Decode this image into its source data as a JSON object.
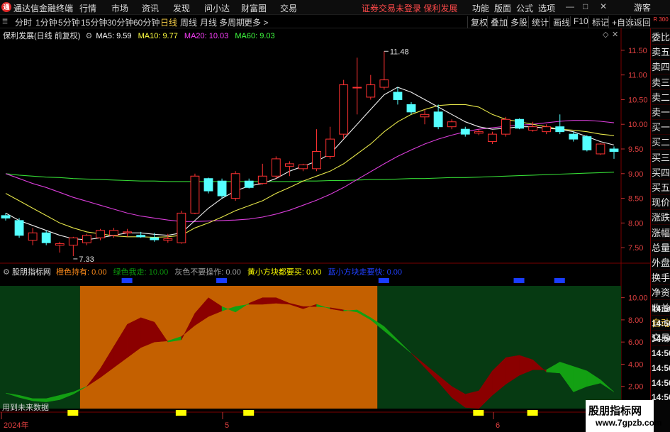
{
  "app": {
    "title": "通达信金融终端",
    "notice": "证券交易未登录  保利发展",
    "logo_char": "通",
    "user_btn": "游客",
    "win_btns": [
      "—",
      "□",
      "✕"
    ]
  },
  "menu": [
    "行情",
    "市场",
    "资讯",
    "发现",
    "问小达",
    "财富圈",
    "交易"
  ],
  "right_menu": [
    "功能",
    "版面",
    "公式",
    "选项"
  ],
  "periods": [
    "分时",
    "1分钟",
    "5分钟",
    "15分钟",
    "30分钟",
    "60分钟",
    "日线",
    "周线",
    "月线",
    "多周期",
    "更多 >"
  ],
  "active_period": "日线",
  "tools": [
    "复权",
    "叠加",
    "多股",
    "统计",
    "画线",
    "F10",
    "标记",
    "+自选",
    "返回"
  ],
  "sidebar": [
    "委比",
    "卖五",
    "卖四",
    "卖三",
    "卖二",
    "卖一",
    "买一",
    "买二",
    "买三",
    "买四",
    "买五",
    "现价",
    "涨跌",
    "涨幅",
    "总量",
    "外盘",
    "换手",
    "净资",
    "收益",
    "自动",
    "交易"
  ],
  "sidebar_hl": "自动",
  "sidebar_top": "R\n300",
  "times": [
    "14:56",
    "14:56",
    "14:56",
    "14:56",
    "14:56",
    "14:56",
    "14:56"
  ],
  "main_chart": {
    "title": "保利发展(日线 前复权)",
    "ma": [
      {
        "label": "MA5: 9.59",
        "color": "#ffffff"
      },
      {
        "label": "MA10: 9.77",
        "color": "#ffff40"
      },
      {
        "label": "MA20: 10.03",
        "color": "#ff40ff"
      },
      {
        "label": "MA60: 9.03",
        "color": "#40ff40"
      }
    ],
    "high_label": "11.48",
    "low_label": "7.33",
    "y_labels": [
      "11.50",
      "11.00",
      "10.50",
      "10.00",
      "9.50",
      "9.00",
      "8.50",
      "8.00",
      "7.50"
    ]
  },
  "indicator": {
    "name": "股朋指标网",
    "legend": [
      {
        "label": "橙色持有: 0.00",
        "color": "#ff8c1a"
      },
      {
        "label": "绿色我走: 10.00",
        "color": "#0c9a0c"
      },
      {
        "label": "灰色不要操作: 0.00",
        "color": "#a0a0a0"
      },
      {
        "label": "黄小方块都要买: 0.00",
        "color": "#ffff00"
      },
      {
        "label": "蓝小方块走要快: 0.00",
        "color": "#2040ff"
      }
    ],
    "y_labels": [
      "10.00",
      "8.00",
      "6.00",
      "4.00",
      "2.00"
    ],
    "footer": "用到未来数据"
  },
  "x_axis": {
    "labels": [
      "2024年",
      "5",
      "6"
    ]
  },
  "watermark": {
    "line1": "股朋指标网",
    "line2": "www.7gpzb.com"
  },
  "chart_data": {
    "type": "candlestick",
    "title": "保利发展(日线 前复权)",
    "ylim": [
      7.2,
      11.8
    ],
    "up_color": "#ff3232",
    "down_color": "#54ffff",
    "candles": [
      {
        "o": 8.15,
        "h": 8.2,
        "l": 8.05,
        "c": 8.1
      },
      {
        "o": 8.05,
        "h": 8.1,
        "l": 7.7,
        "c": 7.75
      },
      {
        "o": 7.65,
        "h": 7.9,
        "l": 7.55,
        "c": 7.8
      },
      {
        "o": 7.8,
        "h": 7.85,
        "l": 7.55,
        "c": 7.6
      },
      {
        "o": 7.55,
        "h": 7.62,
        "l": 7.4,
        "c": 7.58
      },
      {
        "o": 7.55,
        "h": 7.72,
        "l": 7.33,
        "c": 7.7
      },
      {
        "o": 7.6,
        "h": 7.78,
        "l": 7.55,
        "c": 7.75
      },
      {
        "o": 7.7,
        "h": 7.88,
        "l": 7.65,
        "c": 7.85
      },
      {
        "o": 7.75,
        "h": 7.9,
        "l": 7.7,
        "c": 7.85
      },
      {
        "o": 7.8,
        "h": 7.88,
        "l": 7.72,
        "c": 7.82
      },
      {
        "o": 7.75,
        "h": 7.82,
        "l": 7.7,
        "c": 7.72
      },
      {
        "o": 7.7,
        "h": 7.8,
        "l": 7.62,
        "c": 7.66
      },
      {
        "o": 7.65,
        "h": 7.78,
        "l": 7.6,
        "c": 7.68
      },
      {
        "o": 7.6,
        "h": 8.25,
        "l": 7.58,
        "c": 8.2
      },
      {
        "o": 8.2,
        "h": 9.0,
        "l": 8.18,
        "c": 8.95
      },
      {
        "o": 8.9,
        "h": 8.92,
        "l": 8.6,
        "c": 8.65
      },
      {
        "o": 8.85,
        "h": 8.9,
        "l": 8.5,
        "c": 8.55
      },
      {
        "o": 8.5,
        "h": 9.05,
        "l": 8.45,
        "c": 9.0
      },
      {
        "o": 8.85,
        "h": 8.9,
        "l": 8.7,
        "c": 8.72
      },
      {
        "o": 8.8,
        "h": 9.2,
        "l": 8.78,
        "c": 8.95
      },
      {
        "o": 8.95,
        "h": 9.35,
        "l": 8.9,
        "c": 9.3
      },
      {
        "o": 9.15,
        "h": 9.25,
        "l": 8.95,
        "c": 9.2
      },
      {
        "o": 9.1,
        "h": 9.2,
        "l": 9.05,
        "c": 9.18
      },
      {
        "o": 9.1,
        "h": 9.9,
        "l": 9.05,
        "c": 9.45
      },
      {
        "o": 9.35,
        "h": 9.95,
        "l": 9.3,
        "c": 9.7
      },
      {
        "o": 9.8,
        "h": 10.9,
        "l": 9.7,
        "c": 10.8
      },
      {
        "o": 10.75,
        "h": 11.35,
        "l": 10.2,
        "c": 10.75
      },
      {
        "o": 10.55,
        "h": 11.0,
        "l": 10.5,
        "c": 10.8
      },
      {
        "o": 10.75,
        "h": 11.48,
        "l": 10.7,
        "c": 10.9
      },
      {
        "o": 10.65,
        "h": 10.75,
        "l": 10.4,
        "c": 10.5
      },
      {
        "o": 10.4,
        "h": 10.45,
        "l": 10.2,
        "c": 10.25
      },
      {
        "o": 10.15,
        "h": 10.3,
        "l": 10.0,
        "c": 10.2
      },
      {
        "o": 10.25,
        "h": 10.4,
        "l": 9.9,
        "c": 9.95
      },
      {
        "o": 9.95,
        "h": 10.1,
        "l": 9.9,
        "c": 10.05
      },
      {
        "o": 9.9,
        "h": 9.95,
        "l": 9.75,
        "c": 9.8
      },
      {
        "o": 9.82,
        "h": 9.9,
        "l": 9.78,
        "c": 9.85
      },
      {
        "o": 9.65,
        "h": 9.85,
        "l": 9.6,
        "c": 9.8
      },
      {
        "o": 9.8,
        "h": 10.15,
        "l": 9.75,
        "c": 10.1
      },
      {
        "o": 10.1,
        "h": 10.12,
        "l": 9.9,
        "c": 9.92
      },
      {
        "o": 9.88,
        "h": 10.05,
        "l": 9.85,
        "c": 9.95
      },
      {
        "o": 9.85,
        "h": 10.0,
        "l": 9.8,
        "c": 9.95
      },
      {
        "o": 9.95,
        "h": 10.2,
        "l": 9.8,
        "c": 9.85
      },
      {
        "o": 9.8,
        "h": 9.85,
        "l": 9.65,
        "c": 9.7
      },
      {
        "o": 9.75,
        "h": 9.78,
        "l": 9.45,
        "c": 9.48
      },
      {
        "o": 9.4,
        "h": 9.62,
        "l": 9.38,
        "c": 9.6
      },
      {
        "o": 9.5,
        "h": 9.55,
        "l": 9.3,
        "c": 9.45
      }
    ],
    "ma5": [
      8.2,
      8.05,
      7.95,
      7.85,
      7.75,
      7.68,
      7.66,
      7.7,
      7.75,
      7.8,
      7.8,
      7.77,
      7.75,
      7.8,
      8.05,
      8.3,
      8.5,
      8.65,
      8.75,
      8.8,
      8.9,
      9.05,
      9.15,
      9.25,
      9.4,
      9.7,
      10.0,
      10.3,
      10.6,
      10.75,
      10.65,
      10.5,
      10.35,
      10.2,
      10.05,
      9.95,
      9.9,
      9.92,
      9.95,
      9.95,
      9.92,
      9.9,
      9.85,
      9.75,
      9.65,
      9.58
    ],
    "ma10": [
      8.6,
      8.45,
      8.3,
      8.15,
      8.0,
      7.9,
      7.82,
      7.78,
      7.74,
      7.72,
      7.72,
      7.71,
      7.72,
      7.75,
      7.9,
      8.0,
      8.12,
      8.25,
      8.35,
      8.45,
      8.6,
      8.72,
      8.85,
      8.95,
      9.05,
      9.2,
      9.4,
      9.6,
      9.85,
      10.05,
      10.2,
      10.3,
      10.38,
      10.4,
      10.4,
      10.35,
      10.2,
      10.1,
      10.05,
      10.0,
      9.95,
      9.9,
      9.88,
      9.85,
      9.8,
      9.77
    ],
    "ma20": [
      9.0,
      8.9,
      8.8,
      8.72,
      8.62,
      8.52,
      8.44,
      8.36,
      8.28,
      8.2,
      8.14,
      8.1,
      8.06,
      8.03,
      8.03,
      8.04,
      8.05,
      8.06,
      8.08,
      8.12,
      8.18,
      8.26,
      8.36,
      8.46,
      8.58,
      8.72,
      8.88,
      9.04,
      9.2,
      9.35,
      9.48,
      9.6,
      9.7,
      9.78,
      9.85,
      9.9,
      9.93,
      9.96,
      9.98,
      10.0,
      10.03,
      10.06,
      10.08,
      10.08,
      10.06,
      10.03
    ],
    "ma60": [
      9.0,
      8.97,
      8.95,
      8.93,
      8.92,
      8.9,
      8.89,
      8.88,
      8.87,
      8.86,
      8.85,
      8.85,
      8.84,
      8.84,
      8.84,
      8.84,
      8.84,
      8.84,
      8.84,
      8.84,
      8.84,
      8.84,
      8.85,
      8.85,
      8.86,
      8.86,
      8.87,
      8.88,
      8.88,
      8.89,
      8.9,
      8.9,
      8.91,
      8.92,
      8.92,
      8.93,
      8.94,
      8.95,
      8.96,
      8.97,
      8.98,
      8.99,
      9.0,
      9.01,
      9.02,
      9.03
    ],
    "indicator": {
      "ylim": [
        0,
        11
      ],
      "zones": [
        {
          "from": 0,
          "to": 6,
          "state": "green"
        },
        {
          "from": 6,
          "to": 28,
          "state": "orange"
        },
        {
          "from": 28,
          "to": 46,
          "state": "green"
        }
      ],
      "line_a": [
        1.4,
        1.0,
        0.7,
        0.6,
        0.8,
        1.3,
        2.0,
        3.6,
        5.6,
        7.6,
        8.2,
        7.8,
        6.0,
        6.2,
        8.6,
        10.0,
        9.2,
        8.7,
        9.5,
        10.0,
        10.0,
        9.5,
        9.2,
        9.2,
        9.1,
        8.9,
        8.7,
        8.0,
        7.0,
        6.0,
        5.0,
        4.0,
        3.0,
        2.0,
        1.3,
        1.6,
        3.4,
        4.6,
        4.8,
        4.4,
        3.3,
        3.2,
        1.5,
        2.0,
        2.3,
        1.5
      ],
      "line_b": [
        1.4,
        1.2,
        0.9,
        0.9,
        1.2,
        1.5,
        2.0,
        2.8,
        3.7,
        4.6,
        5.5,
        6.0,
        6.1,
        6.5,
        7.5,
        8.3,
        8.8,
        9.2,
        9.4,
        9.4,
        9.5,
        9.4,
        9.0,
        9.4,
        9.0,
        8.8,
        8.9,
        8.2,
        7.4,
        6.2,
        5.0,
        3.7,
        2.4,
        1.0,
        0.1,
        0.0,
        1.2,
        2.2,
        3.0,
        3.5,
        3.5,
        4.2,
        3.8,
        3.4,
        2.6,
        1.5
      ],
      "yellow_markers": [
        5,
        13,
        18,
        35,
        39
      ],
      "blue_markers": [
        9,
        16,
        28,
        38,
        41
      ]
    }
  }
}
